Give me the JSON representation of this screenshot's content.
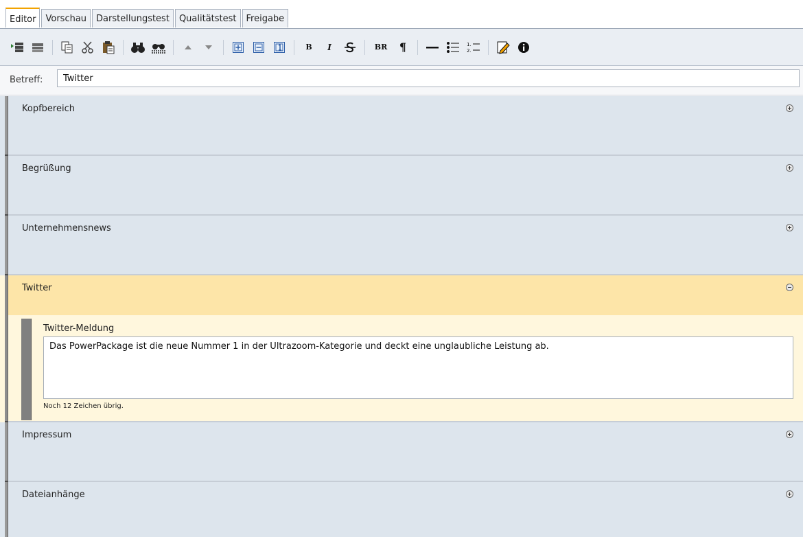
{
  "tabs": [
    {
      "label": "Editor",
      "active": true
    },
    {
      "label": "Vorschau",
      "active": false
    },
    {
      "label": "Darstellungstest",
      "active": false
    },
    {
      "label": "Qualitätstest",
      "active": false
    },
    {
      "label": "Freigabe",
      "active": false
    }
  ],
  "toolbar": {
    "bold_label": "B",
    "italic_label": "I",
    "br_label": "BR",
    "pilcrow_label": "¶",
    "icons": [
      "insert-section-icon",
      "delete-section-icon",
      "copy-icon",
      "cut-icon",
      "paste-icon",
      "find-icon",
      "find-replace-icon",
      "move-up-icon",
      "move-down-icon",
      "expand-all-icon",
      "collapse-all-icon",
      "numbered-box-icon",
      "bold-icon",
      "italic-icon",
      "strikethrough-icon",
      "line-break-icon",
      "paragraph-icon",
      "horizontal-rule-icon",
      "bullet-list-icon",
      "numbered-list-icon",
      "edit-source-icon",
      "info-icon"
    ]
  },
  "subject": {
    "label": "Betreff:",
    "value": "Twitter"
  },
  "sections": [
    {
      "title": "Kopfbereich",
      "expanded": false
    },
    {
      "title": "Begrüßung",
      "expanded": false
    },
    {
      "title": "Unternehmensnews",
      "expanded": false
    },
    {
      "title": "Twitter",
      "expanded": true,
      "field_label": "Twitter-Meldung",
      "field_value": "Das PowerPackage ist die neue Nummer 1 in der Ultrazoom-Kategorie und deckt eine unglaubliche Leistung ab.",
      "hint": "Noch 12 Zeichen übrig."
    },
    {
      "title": "Impressum",
      "expanded": false
    },
    {
      "title": "Dateianhänge",
      "expanded": false
    }
  ],
  "colors": {
    "collapsed_bg": "#dde5ed",
    "expanded_header": "#fde5a8",
    "expanded_body": "#fff7dd",
    "active_tab_accent": "#f2a300"
  }
}
